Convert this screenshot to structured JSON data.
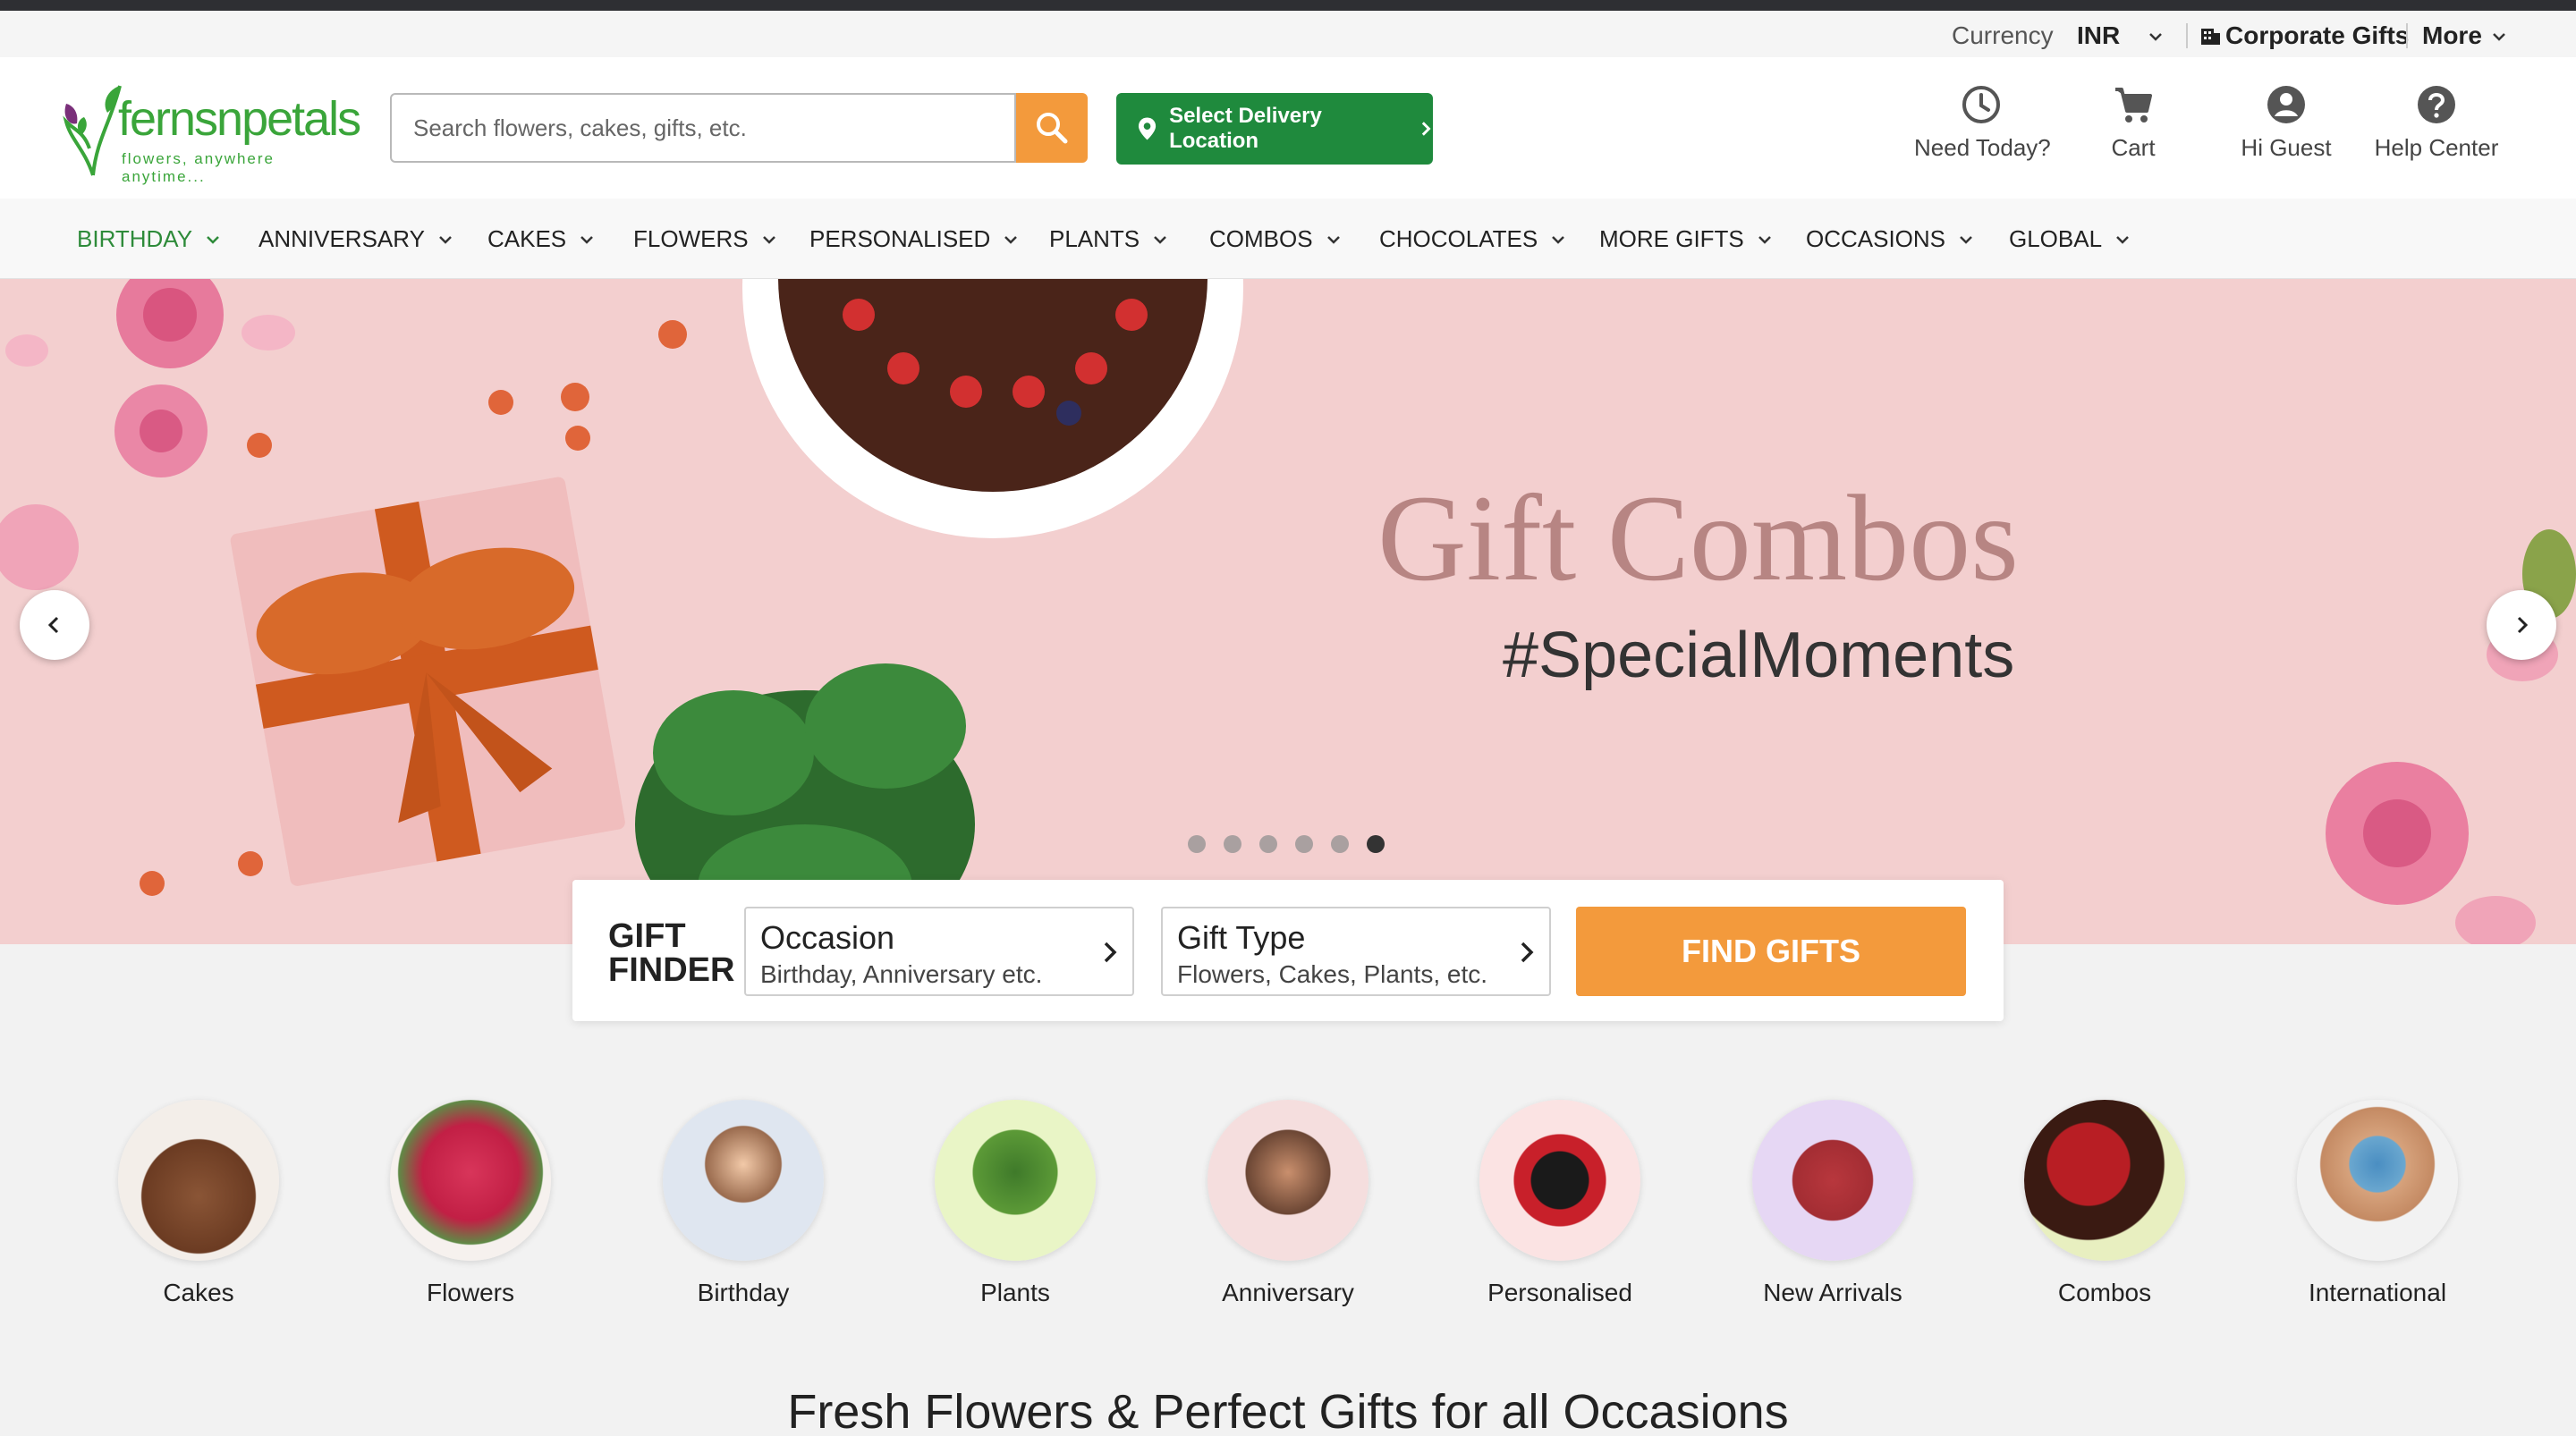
{
  "utility": {
    "currency_label": "Currency",
    "currency_value": "INR",
    "corporate_gifts": "Corporate Gifts",
    "more": "More"
  },
  "header": {
    "logo_word": "fernsnpetals",
    "logo_tagline": "flowers, anywhere anytime...",
    "search_placeholder": "Search flowers, cakes, gifts, etc.",
    "delivery_button": "Select Delivery Location",
    "icons": [
      {
        "label": "Need Today?",
        "icon": "clock-icon"
      },
      {
        "label": "Cart",
        "icon": "cart-icon"
      },
      {
        "label": "Hi Guest",
        "icon": "user-icon"
      },
      {
        "label": "Help Center",
        "icon": "help-icon"
      }
    ]
  },
  "nav": {
    "items": [
      "BIRTHDAY",
      "ANNIVERSARY",
      "CAKES",
      "FLOWERS",
      "PERSONALISED",
      "PLANTS",
      "COMBOS",
      "CHOCOLATES",
      "MORE GIFTS",
      "OCCASIONS",
      "GLOBAL"
    ],
    "active": "BIRTHDAY"
  },
  "banner": {
    "title": "Gift Combos",
    "subtitle": "#SpecialMoments",
    "slide_count": 6,
    "active_slide": 6
  },
  "gift_finder": {
    "label_line1": "GIFT",
    "label_line2": "FINDER",
    "occasion_title": "Occasion",
    "occasion_sub": "Birthday, Anniversary etc.",
    "type_title": "Gift Type",
    "type_sub": "Flowers, Cakes, Plants, etc.",
    "button": "FIND GIFTS"
  },
  "categories": [
    "Cakes",
    "Flowers",
    "Birthday",
    "Plants",
    "Anniversary",
    "Personalised",
    "New Arrivals",
    "Combos",
    "International"
  ],
  "section_heading": "Fresh Flowers & Perfect Gifts for all Occasions",
  "colors": {
    "brand_green": "#2e8b3a",
    "accent_orange": "#f39a3c",
    "banner_pink": "#f3cfcf"
  }
}
